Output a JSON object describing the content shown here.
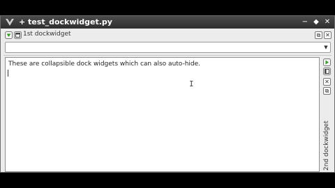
{
  "window": {
    "title": "+ test_dockwidget.py",
    "controls": {
      "minimize": "−",
      "maximize": "◆",
      "close": "✕"
    }
  },
  "dock1": {
    "title": "1st dockwidget",
    "buttons": {
      "float": "⧉",
      "close": "✕"
    }
  },
  "combo": {
    "value": ""
  },
  "editor": {
    "text": "These are collapsible dock widgets which can also auto-hide.",
    "cursor_glyph": "I"
  },
  "dock2": {
    "title": "2nd dockwidget",
    "buttons": {
      "float": "⧉",
      "close": "✕"
    }
  },
  "colors": {
    "titlebar": "#3a3a3a",
    "window_bg": "#ececec",
    "accent_green": "#3a9a2a"
  }
}
